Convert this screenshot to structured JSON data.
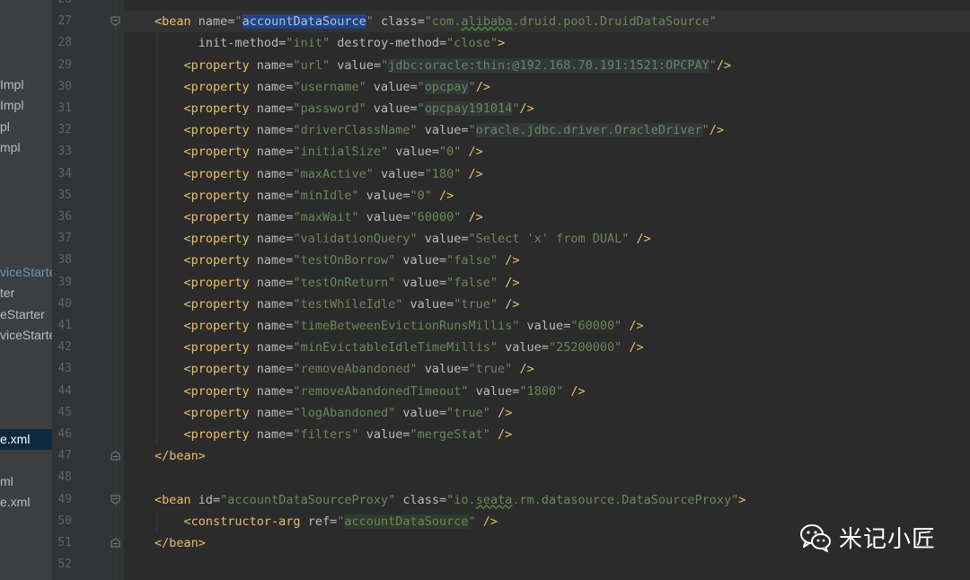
{
  "sidebar": {
    "items": [
      {
        "label": "Impl",
        "style": "normal"
      },
      {
        "label": "Impl",
        "style": "normal"
      },
      {
        "label": "pl",
        "style": "normal"
      },
      {
        "label": "mpl",
        "style": "normal"
      },
      {
        "label": "viceStarter",
        "style": "blue"
      },
      {
        "label": "ter",
        "style": "normal"
      },
      {
        "label": "eStarter",
        "style": "normal"
      },
      {
        "label": "viceStarte",
        "style": "normal"
      },
      {
        "label": "e.xml",
        "style": "selected"
      },
      {
        "label": "ml",
        "style": "normal"
      },
      {
        "label": "e.xml",
        "style": "normal"
      }
    ]
  },
  "editor": {
    "current_line": 27,
    "lines": [
      {
        "n": "26",
        "tokens": []
      },
      {
        "n": "27",
        "tokens": [
          {
            "t": "t",
            "s": "<bean "
          },
          {
            "t": "a",
            "s": "name="
          },
          {
            "t": "v",
            "s": "\""
          },
          {
            "t": "hl",
            "s": "accountDataSource"
          },
          {
            "t": "v",
            "s": "\""
          },
          {
            "t": "p",
            "s": " "
          },
          {
            "t": "a",
            "s": "class="
          },
          {
            "t": "v",
            "s": "\"com."
          },
          {
            "t": "vsq",
            "s": "alibaba"
          },
          {
            "t": "v",
            "s": ".druid.pool.DruidDataSource\""
          }
        ]
      },
      {
        "n": "28",
        "tokens": [
          {
            "t": "a",
            "s": "      init-method="
          },
          {
            "t": "v",
            "s": "\"init\""
          },
          {
            "t": "p",
            "s": " "
          },
          {
            "t": "a",
            "s": "destroy-method="
          },
          {
            "t": "v",
            "s": "\"close\""
          },
          {
            "t": "t",
            "s": ">"
          }
        ]
      },
      {
        "n": "29",
        "tokens": [
          {
            "t": "t",
            "s": "    <property "
          },
          {
            "t": "a",
            "s": "name="
          },
          {
            "t": "v",
            "s": "\"url\""
          },
          {
            "t": "p",
            "s": " "
          },
          {
            "t": "a",
            "s": "value="
          },
          {
            "t": "v",
            "s": "\""
          },
          {
            "t": "bgv",
            "s": "jdbc:oracle:thin:@192.168.70.191:1521:OPCPAY"
          },
          {
            "t": "v",
            "s": "\""
          },
          {
            "t": "t",
            "s": "/>"
          }
        ]
      },
      {
        "n": "30",
        "tokens": [
          {
            "t": "t",
            "s": "    <property "
          },
          {
            "t": "a",
            "s": "name="
          },
          {
            "t": "v",
            "s": "\"username\""
          },
          {
            "t": "p",
            "s": " "
          },
          {
            "t": "a",
            "s": "value="
          },
          {
            "t": "v",
            "s": "\""
          },
          {
            "t": "bgv",
            "s": "opcpay"
          },
          {
            "t": "v",
            "s": "\""
          },
          {
            "t": "t",
            "s": "/>"
          }
        ]
      },
      {
        "n": "31",
        "tokens": [
          {
            "t": "t",
            "s": "    <property "
          },
          {
            "t": "a",
            "s": "name="
          },
          {
            "t": "v",
            "s": "\"password\""
          },
          {
            "t": "p",
            "s": " "
          },
          {
            "t": "a",
            "s": "value="
          },
          {
            "t": "v",
            "s": "\""
          },
          {
            "t": "bgv",
            "s": "opcpay191014"
          },
          {
            "t": "v",
            "s": "\""
          },
          {
            "t": "t",
            "s": "/>"
          }
        ]
      },
      {
        "n": "32",
        "tokens": [
          {
            "t": "t",
            "s": "    <property "
          },
          {
            "t": "a",
            "s": "name="
          },
          {
            "t": "v",
            "s": "\"driverClassName\""
          },
          {
            "t": "p",
            "s": " "
          },
          {
            "t": "a",
            "s": "value="
          },
          {
            "t": "v",
            "s": "\""
          },
          {
            "t": "bgv",
            "s": "oracle.jdbc.driver.OracleDriver"
          },
          {
            "t": "v",
            "s": "\""
          },
          {
            "t": "t",
            "s": "/>"
          }
        ]
      },
      {
        "n": "33",
        "tokens": [
          {
            "t": "t",
            "s": "    <property "
          },
          {
            "t": "a",
            "s": "name="
          },
          {
            "t": "v",
            "s": "\"initialSize\""
          },
          {
            "t": "p",
            "s": " "
          },
          {
            "t": "a",
            "s": "value="
          },
          {
            "t": "v",
            "s": "\"0\""
          },
          {
            "t": "t",
            "s": " />"
          }
        ]
      },
      {
        "n": "34",
        "tokens": [
          {
            "t": "t",
            "s": "    <property "
          },
          {
            "t": "a",
            "s": "name="
          },
          {
            "t": "v",
            "s": "\"maxActive\""
          },
          {
            "t": "p",
            "s": " "
          },
          {
            "t": "a",
            "s": "value="
          },
          {
            "t": "v",
            "s": "\"180\""
          },
          {
            "t": "t",
            "s": " />"
          }
        ]
      },
      {
        "n": "35",
        "tokens": [
          {
            "t": "t",
            "s": "    <property "
          },
          {
            "t": "a",
            "s": "name="
          },
          {
            "t": "v",
            "s": "\"minIdle\""
          },
          {
            "t": "p",
            "s": " "
          },
          {
            "t": "a",
            "s": "value="
          },
          {
            "t": "v",
            "s": "\"0\""
          },
          {
            "t": "t",
            "s": " />"
          }
        ]
      },
      {
        "n": "36",
        "tokens": [
          {
            "t": "t",
            "s": "    <property "
          },
          {
            "t": "a",
            "s": "name="
          },
          {
            "t": "v",
            "s": "\"maxWait\""
          },
          {
            "t": "p",
            "s": " "
          },
          {
            "t": "a",
            "s": "value="
          },
          {
            "t": "v",
            "s": "\"60000\""
          },
          {
            "t": "t",
            "s": " />"
          }
        ]
      },
      {
        "n": "37",
        "tokens": [
          {
            "t": "t",
            "s": "    <property "
          },
          {
            "t": "a",
            "s": "name="
          },
          {
            "t": "v",
            "s": "\"validationQuery\""
          },
          {
            "t": "p",
            "s": " "
          },
          {
            "t": "a",
            "s": "value="
          },
          {
            "t": "v",
            "s": "\"Select 'x' from DUAL\""
          },
          {
            "t": "t",
            "s": " />"
          }
        ]
      },
      {
        "n": "38",
        "tokens": [
          {
            "t": "t",
            "s": "    <property "
          },
          {
            "t": "a",
            "s": "name="
          },
          {
            "t": "v",
            "s": "\"testOnBorrow\""
          },
          {
            "t": "p",
            "s": " "
          },
          {
            "t": "a",
            "s": "value="
          },
          {
            "t": "v",
            "s": "\"false\""
          },
          {
            "t": "t",
            "s": " />"
          }
        ]
      },
      {
        "n": "39",
        "tokens": [
          {
            "t": "t",
            "s": "    <property "
          },
          {
            "t": "a",
            "s": "name="
          },
          {
            "t": "v",
            "s": "\"testOnReturn\""
          },
          {
            "t": "p",
            "s": " "
          },
          {
            "t": "a",
            "s": "value="
          },
          {
            "t": "v",
            "s": "\"false\""
          },
          {
            "t": "t",
            "s": " />"
          }
        ]
      },
      {
        "n": "40",
        "tokens": [
          {
            "t": "t",
            "s": "    <property "
          },
          {
            "t": "a",
            "s": "name="
          },
          {
            "t": "v",
            "s": "\"testWhileIdle\""
          },
          {
            "t": "p",
            "s": " "
          },
          {
            "t": "a",
            "s": "value="
          },
          {
            "t": "v",
            "s": "\"true\""
          },
          {
            "t": "t",
            "s": " />"
          }
        ]
      },
      {
        "n": "41",
        "tokens": [
          {
            "t": "t",
            "s": "    <property "
          },
          {
            "t": "a",
            "s": "name="
          },
          {
            "t": "v",
            "s": "\"timeBetweenEvictionRunsMillis\""
          },
          {
            "t": "p",
            "s": " "
          },
          {
            "t": "a",
            "s": "value="
          },
          {
            "t": "v",
            "s": "\"60000\""
          },
          {
            "t": "t",
            "s": " />"
          }
        ]
      },
      {
        "n": "42",
        "tokens": [
          {
            "t": "t",
            "s": "    <property "
          },
          {
            "t": "a",
            "s": "name="
          },
          {
            "t": "v",
            "s": "\"minEvictableIdleTimeMillis\""
          },
          {
            "t": "p",
            "s": " "
          },
          {
            "t": "a",
            "s": "value="
          },
          {
            "t": "v",
            "s": "\"25200000\""
          },
          {
            "t": "t",
            "s": " />"
          }
        ]
      },
      {
        "n": "43",
        "tokens": [
          {
            "t": "t",
            "s": "    <property "
          },
          {
            "t": "a",
            "s": "name="
          },
          {
            "t": "v",
            "s": "\"removeAbandoned\""
          },
          {
            "t": "p",
            "s": " "
          },
          {
            "t": "a",
            "s": "value="
          },
          {
            "t": "v",
            "s": "\"true\""
          },
          {
            "t": "t",
            "s": " />"
          }
        ]
      },
      {
        "n": "44",
        "tokens": [
          {
            "t": "t",
            "s": "    <property "
          },
          {
            "t": "a",
            "s": "name="
          },
          {
            "t": "v",
            "s": "\"removeAbandonedTimeout\""
          },
          {
            "t": "p",
            "s": " "
          },
          {
            "t": "a",
            "s": "value="
          },
          {
            "t": "v",
            "s": "\"1800\""
          },
          {
            "t": "t",
            "s": " />"
          }
        ]
      },
      {
        "n": "45",
        "tokens": [
          {
            "t": "t",
            "s": "    <property "
          },
          {
            "t": "a",
            "s": "name="
          },
          {
            "t": "v",
            "s": "\"logAbandoned\""
          },
          {
            "t": "p",
            "s": " "
          },
          {
            "t": "a",
            "s": "value="
          },
          {
            "t": "v",
            "s": "\"true\""
          },
          {
            "t": "t",
            "s": " />"
          }
        ]
      },
      {
        "n": "46",
        "tokens": [
          {
            "t": "t",
            "s": "    <property "
          },
          {
            "t": "a",
            "s": "name="
          },
          {
            "t": "v",
            "s": "\"filters\""
          },
          {
            "t": "p",
            "s": " "
          },
          {
            "t": "a",
            "s": "value="
          },
          {
            "t": "v",
            "s": "\"mergeStat\""
          },
          {
            "t": "t",
            "s": " />"
          }
        ]
      },
      {
        "n": "47",
        "tokens": [
          {
            "t": "t",
            "s": "</bean>"
          }
        ]
      },
      {
        "n": "48",
        "tokens": []
      },
      {
        "n": "49",
        "tokens": [
          {
            "t": "t",
            "s": "<bean "
          },
          {
            "t": "a",
            "s": "id="
          },
          {
            "t": "v",
            "s": "\"accountDataSourceProxy\""
          },
          {
            "t": "p",
            "s": " "
          },
          {
            "t": "a",
            "s": "class="
          },
          {
            "t": "v",
            "s": "\"io."
          },
          {
            "t": "vsq",
            "s": "seata"
          },
          {
            "t": "v",
            "s": ".rm.datasource.DataSourceProxy\""
          },
          {
            "t": "t",
            "s": ">"
          }
        ]
      },
      {
        "n": "50",
        "tokens": [
          {
            "t": "t",
            "s": "    <constructor-arg "
          },
          {
            "t": "a",
            "s": "ref="
          },
          {
            "t": "v",
            "s": "\""
          },
          {
            "t": "bgd",
            "s": "accountDataSource"
          },
          {
            "t": "v",
            "s": "\""
          },
          {
            "t": "t",
            "s": " />"
          }
        ]
      },
      {
        "n": "51",
        "tokens": [
          {
            "t": "t",
            "s": "</bean>"
          }
        ]
      },
      {
        "n": "52",
        "tokens": []
      }
    ]
  },
  "watermark": {
    "text": "米记小匠",
    "icon": "wechat-icon"
  },
  "colors": {
    "tag": "#e8bf6a",
    "attribute": "#bababa",
    "value": "#6a8759",
    "selection": "#214283",
    "background": "#2b2b2b"
  }
}
